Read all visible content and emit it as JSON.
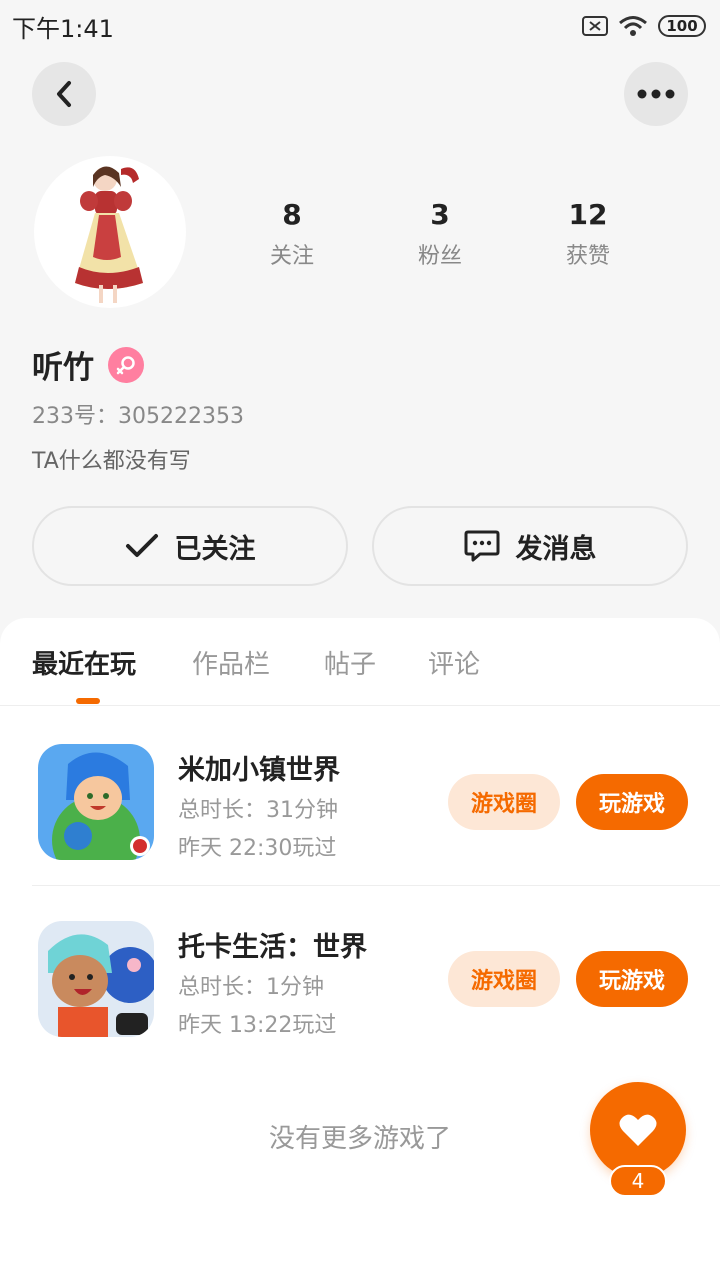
{
  "status_bar": {
    "time": "下午1:41",
    "battery": "100"
  },
  "profile": {
    "stats": [
      {
        "value": "8",
        "label": "关注"
      },
      {
        "value": "3",
        "label": "粉丝"
      },
      {
        "value": "12",
        "label": "获赞"
      }
    ],
    "username": "听竹",
    "gender_icon": "female-icon",
    "user_id": "233号：305222353",
    "bio": "TA什么都没有写",
    "follow_label": "已关注",
    "message_label": "发消息"
  },
  "tabs": [
    "最近在玩",
    "作品栏",
    "帖子",
    "评论"
  ],
  "active_tab": "最近在玩",
  "games": [
    {
      "name": "米加小镇世界",
      "duration": "总时长：31分钟",
      "last_played": "昨天 22:30玩过",
      "circle_label": "游戏圈",
      "play_label": "玩游戏"
    },
    {
      "name": "托卡生活：世界",
      "duration": "总时长：1分钟",
      "last_played": "昨天 13:22玩过",
      "circle_label": "游戏圈",
      "play_label": "玩游戏"
    }
  ],
  "empty_message": "没有更多游戏了",
  "like": {
    "count": "4",
    "icon": "heart-icon"
  },
  "colors": {
    "accent": "#f56a00",
    "accent_light": "#fde7d6",
    "female": "#ff7fa0"
  }
}
